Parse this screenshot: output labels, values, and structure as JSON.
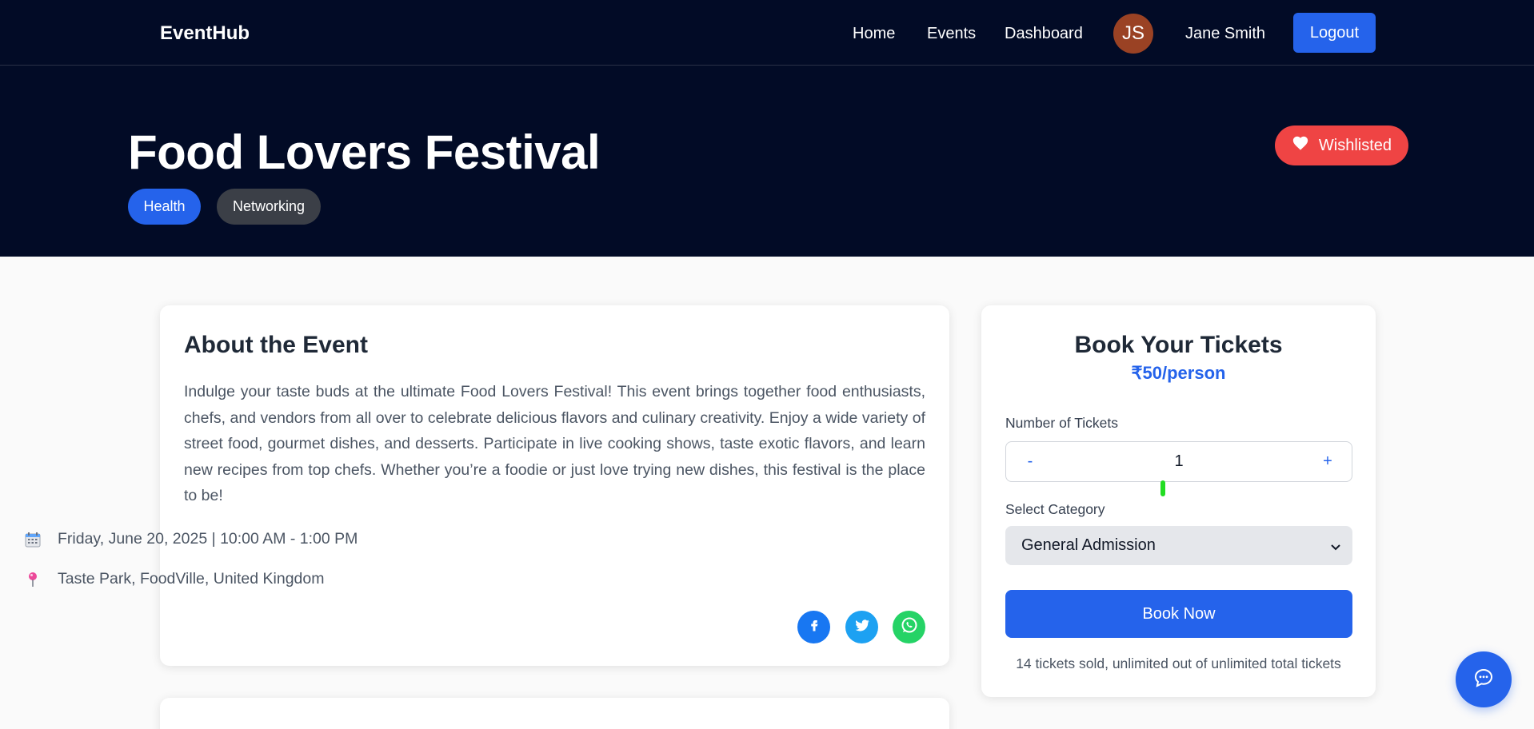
{
  "navbar": {
    "brand": "EventHub",
    "links": [
      "Home",
      "Events",
      "Dashboard"
    ],
    "avatar_initials": "JS",
    "user_name": "Jane Smith",
    "logout_label": "Logout"
  },
  "hero": {
    "title": "Food Lovers Festival",
    "tags": [
      "Health",
      "Networking"
    ],
    "wishlist_label": "Wishlisted"
  },
  "about": {
    "title": "About the Event",
    "description": "Indulge your taste buds at the ultimate Food Lovers Festival! This event brings together food enthusiasts, chefs, and vendors from all over to celebrate delicious flavors and culinary creativity. Enjoy a wide variety of street food, gourmet dishes, and desserts. Participate in live cooking shows, taste exotic flavors, and learn new recipes from top chefs. Whether you’re a foodie or just love trying new dishes, this festival is the place to be!",
    "date_time": "Friday, June 20, 2025 | 10:00 AM - 1:00 PM",
    "location": "Taste Park, FoodVille, United Kingdom",
    "share_icons": [
      "facebook-icon",
      "twitter-icon",
      "whatsapp-icon"
    ]
  },
  "booking": {
    "title": "Book Your Tickets",
    "price": "₹50/person",
    "tickets_label": "Number of Tickets",
    "minus_label": "-",
    "plus_label": "+",
    "ticket_count": "1",
    "category_label": "Select Category",
    "category_value": "General Admission",
    "book_label": "Book Now",
    "sold_text": "14 tickets sold, unlimited out of unlimited total tickets"
  },
  "colors": {
    "navy": "#020b26",
    "primary": "#2563eb",
    "danger": "#ef4444",
    "tag_dark": "#3b3f47"
  }
}
